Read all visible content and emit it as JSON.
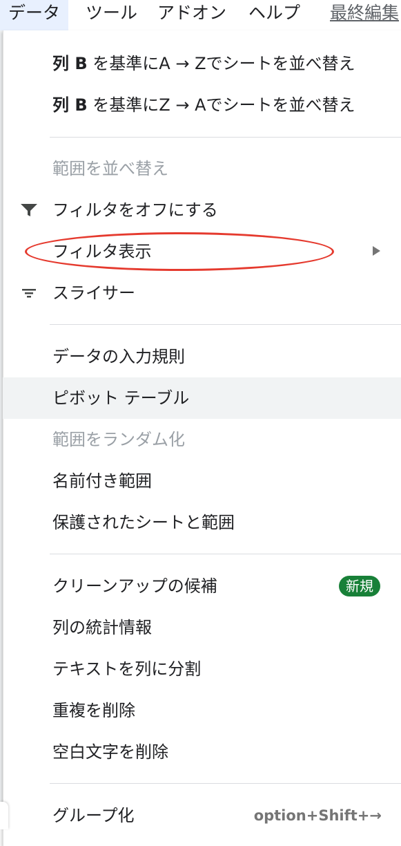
{
  "menubar": {
    "items": [
      "データ",
      "ツール",
      "アドオン",
      "ヘルプ",
      "最終編集"
    ]
  },
  "menu": {
    "sort_az": {
      "prefix": "列 B",
      "rest": " を基準にA → Zでシートを並べ替え"
    },
    "sort_za": {
      "prefix": "列 B",
      "rest": " を基準にZ → Aでシートを並べ替え"
    },
    "sort_range": "範囲を並べ替え",
    "filter_off": "フィルタをオフにする",
    "filter_views": "フィルタ表示",
    "slicer": "スライサー",
    "data_validation": "データの入力規則",
    "pivot_table": "ピボット テーブル",
    "randomize_range": "範囲をランダム化",
    "named_ranges": "名前付き範囲",
    "protected_sheets": "保護されたシートと範囲",
    "cleanup_suggestions": "クリーンアップの候補",
    "new_badge": "新規",
    "column_stats": "列の統計情報",
    "split_text": "テキストを列に分割",
    "remove_duplicates": "重複を削除",
    "trim_whitespace": "空白文字を削除",
    "group": "グループ化",
    "group_shortcut": "option+Shift+→"
  },
  "colors": {
    "annotation": "#e53a2e",
    "badge": "#188038",
    "disabled_text": "#9aa0a6",
    "highlight": "#f1f3f4"
  }
}
